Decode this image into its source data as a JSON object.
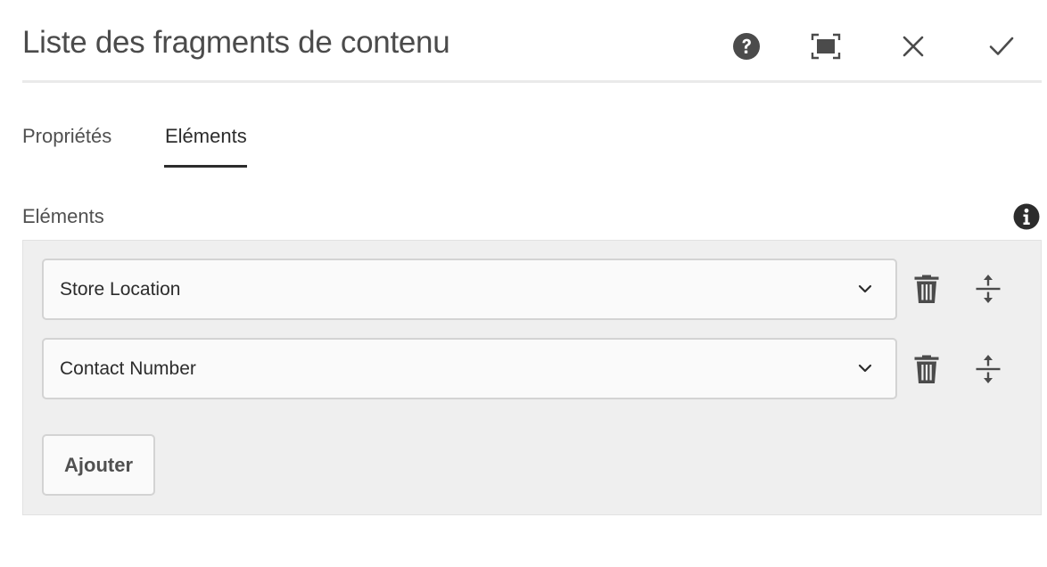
{
  "dialog": {
    "title": "Liste des fragments de contenu",
    "header_icons": [
      "help-icon",
      "fullscreen-icon",
      "close-icon",
      "checkmark-icon"
    ]
  },
  "tabs": [
    {
      "label": "Propriétés",
      "active": false
    },
    {
      "label": "Eléments",
      "active": true
    }
  ],
  "elements_field": {
    "label": "Eléments",
    "items": [
      {
        "value": "Store Location"
      },
      {
        "value": "Contact Number"
      }
    ],
    "add_label": "Ajouter"
  },
  "colors": {
    "icon": "#4b4b4b",
    "panel_bg": "#efefef",
    "field_bg": "#fafafa",
    "border": "#d3d3d3"
  }
}
